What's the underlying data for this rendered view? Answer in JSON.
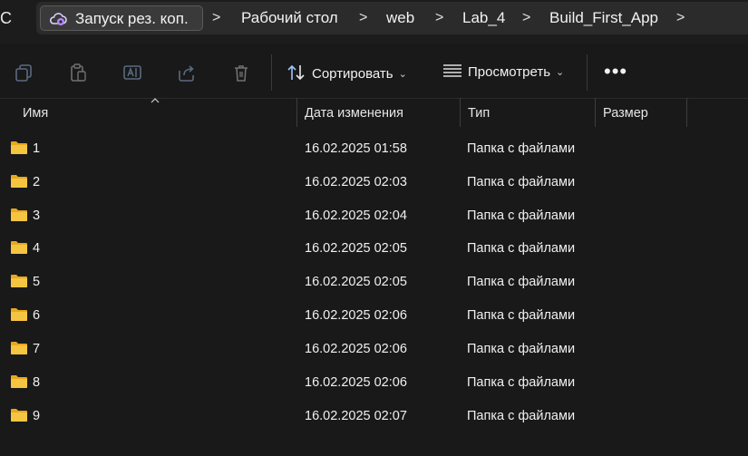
{
  "address": {
    "refresh_glyph": "C",
    "crumbs": [
      "Запуск рез. коп.",
      "Рабочий стол",
      "web",
      "Lab_4",
      "Build_First_App"
    ],
    "separator": ">"
  },
  "toolbar": {
    "sort_label": "Сортировать",
    "view_label": "Просмотреть",
    "more_label": "•••"
  },
  "columns": {
    "name": "Имя",
    "date": "Дата изменения",
    "type": "Тип",
    "size": "Размер"
  },
  "rows": [
    {
      "name": "1",
      "date": "16.02.2025 01:58",
      "type": "Папка с файлами",
      "size": ""
    },
    {
      "name": "2",
      "date": "16.02.2025 02:03",
      "type": "Папка с файлами",
      "size": ""
    },
    {
      "name": "3",
      "date": "16.02.2025 02:04",
      "type": "Папка с файлами",
      "size": ""
    },
    {
      "name": "4",
      "date": "16.02.2025 02:05",
      "type": "Папка с файлами",
      "size": ""
    },
    {
      "name": "5",
      "date": "16.02.2025 02:05",
      "type": "Папка с файлами",
      "size": ""
    },
    {
      "name": "6",
      "date": "16.02.2025 02:06",
      "type": "Папка с файлами",
      "size": ""
    },
    {
      "name": "7",
      "date": "16.02.2025 02:06",
      "type": "Папка с файлами",
      "size": ""
    },
    {
      "name": "8",
      "date": "16.02.2025 02:06",
      "type": "Папка с файлами",
      "size": ""
    },
    {
      "name": "9",
      "date": "16.02.2025 02:07",
      "type": "Папка с файлами",
      "size": ""
    }
  ],
  "icons": {
    "backup": "cloud-backup-icon",
    "copy": "copy-icon",
    "paste": "paste-icon",
    "rename": "rename-icon",
    "share": "share-icon",
    "delete": "delete-icon",
    "sort": "sort-icon",
    "view": "view-icon",
    "folder": "folder-icon"
  },
  "colors": {
    "background": "#191919",
    "folder": "#f5c542",
    "backup_accent": "#b388ff"
  }
}
